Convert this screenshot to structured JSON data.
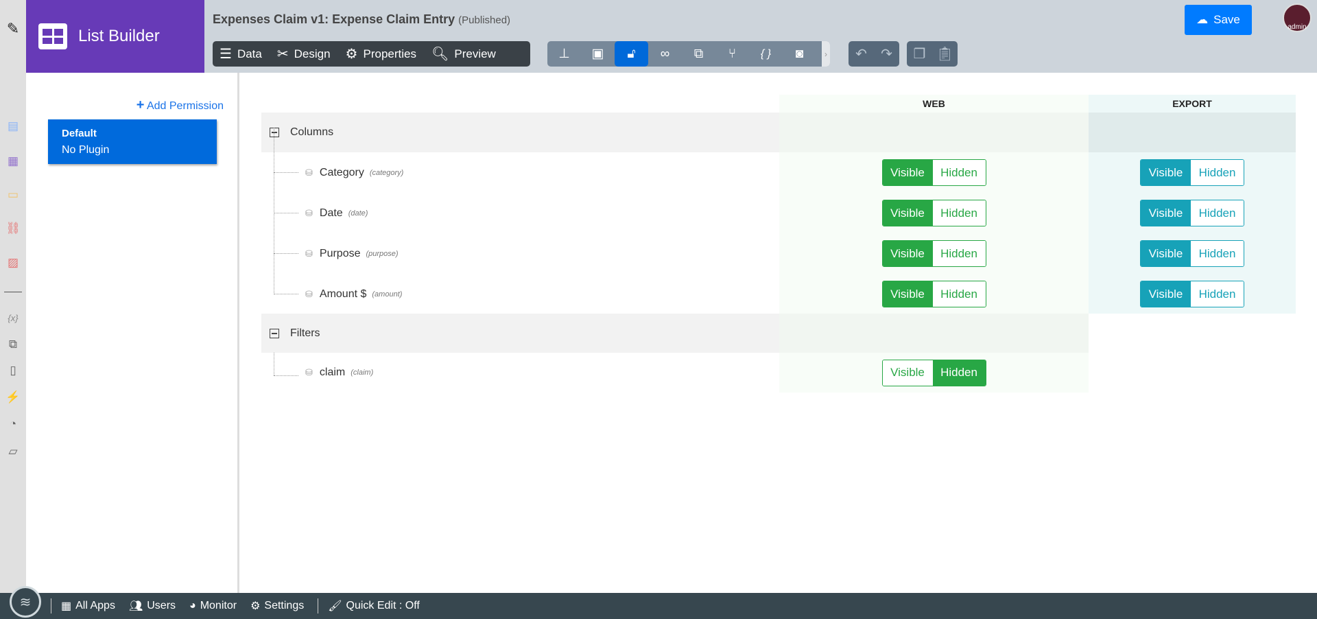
{
  "app": {
    "name": "List Builder",
    "title": "Expenses Claim v1: Expense Claim Entry",
    "status": "(Published)"
  },
  "tabs": [
    {
      "label": "Data",
      "icon": "table-icon"
    },
    {
      "label": "Design",
      "icon": "design-icon"
    },
    {
      "label": "Properties",
      "icon": "gear-icon"
    },
    {
      "label": "Preview",
      "icon": "preview-icon"
    }
  ],
  "tools": [
    "tree-icon",
    "form-icon",
    "lock-icon",
    "binoculars-icon",
    "translate-icon",
    "branch-icon",
    "braces-icon",
    "camera-icon"
  ],
  "save_label": "Save",
  "avatar_label": "admin",
  "left": {
    "add_label": "Add Permission",
    "items": [
      {
        "name": "Default",
        "plugin": "No Plugin"
      }
    ]
  },
  "table": {
    "headers": {
      "web": "WEB",
      "export": "EXPORT"
    },
    "groups": [
      {
        "label": "Columns",
        "fields": [
          {
            "label": "Category",
            "code": "(category)",
            "web": "Visible",
            "export": "Visible"
          },
          {
            "label": "Date",
            "code": "(date)",
            "web": "Visible",
            "export": "Visible"
          },
          {
            "label": "Purpose",
            "code": "(purpose)",
            "web": "Visible",
            "export": "Visible"
          },
          {
            "label": "Amount $",
            "code": "(amount)",
            "web": "Visible",
            "export": "Visible"
          }
        ]
      },
      {
        "label": "Filters",
        "fields": [
          {
            "label": "claim",
            "code": "(claim)",
            "web": "Hidden"
          }
        ]
      }
    ],
    "visible_label": "Visible",
    "hidden_label": "Hidden"
  },
  "footer": {
    "all_apps": "All Apps",
    "users": "Users",
    "monitor": "Monitor",
    "settings": "Settings",
    "quick_edit": "Quick Edit : Off"
  },
  "colors": {
    "brand": "#673ab7",
    "web": "#28a745",
    "export": "#17a2b8",
    "selected": "#006adc"
  }
}
